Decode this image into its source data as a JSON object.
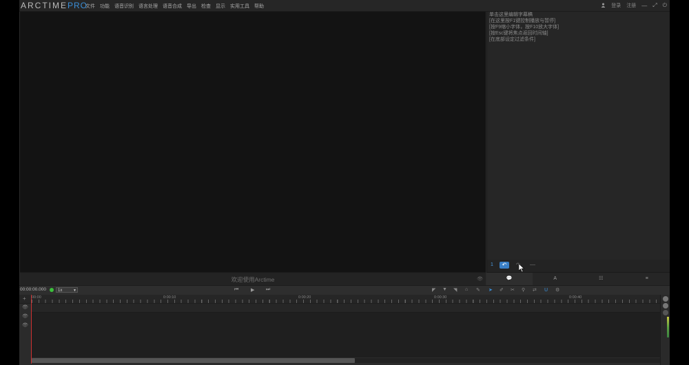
{
  "app": {
    "logo_main": "ARCTIME",
    "logo_pro": "PRO"
  },
  "menu": [
    "文件",
    "功能",
    "语音识别",
    "语言处理",
    "语音合成",
    "导出",
    "检查",
    "显示",
    "实用工具",
    "帮助"
  ],
  "window": {
    "login": "登录",
    "register": "注册",
    "user_icon": "user-icon",
    "minimize": "—",
    "maximize": "⤢",
    "power": "⏻"
  },
  "video": {
    "welcome": "欢迎使用Arctime"
  },
  "subtitle_panel": {
    "tips": "单击这里编辑字幕稿\n[在这里按F1键控制播放与暂停]\n[按F9缩小字体，按F10放大字体]\n[按Esc键将焦点返回时间轴]\n[在底部设定过滤条件]",
    "line_number": "1",
    "tabs": [
      "💬",
      "A",
      "☷",
      "≡"
    ]
  },
  "transport": {
    "timecode": "00:00:00.000",
    "speed": "1x"
  },
  "timeline": {
    "ticks": [
      "00:00",
      "0:00:10",
      "0:00:20",
      "0:00:30",
      "0:00:40"
    ]
  }
}
